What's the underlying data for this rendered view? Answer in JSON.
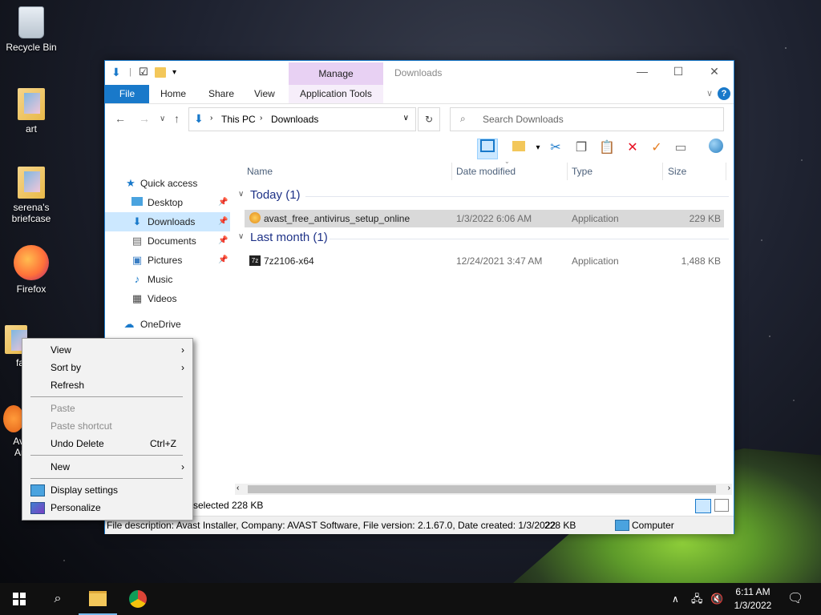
{
  "desktop": {
    "icons": [
      {
        "label": "Recycle Bin"
      },
      {
        "label": "art"
      },
      {
        "label": "serena's briefcase"
      },
      {
        "label": "Firefox"
      },
      {
        "label": "fa"
      },
      {
        "label": "Av\nAr"
      }
    ]
  },
  "window": {
    "title": "Downloads",
    "manage_tab": "Manage",
    "ribbon_tabs": [
      "File",
      "Home",
      "Share",
      "View",
      "Application Tools"
    ],
    "help": "?",
    "breadcrumb": [
      "This PC",
      "Downloads"
    ],
    "search_placeholder": "Search Downloads",
    "columns": [
      "Name",
      "Date modified",
      "Type",
      "Size"
    ],
    "groups": [
      {
        "label": "Today (1)",
        "files": [
          {
            "name": "avast_free_antivirus_setup_online",
            "date": "1/3/2022 6:06 AM",
            "type": "Application",
            "size": "229 KB",
            "selected": true
          }
        ]
      },
      {
        "label": "Last month (1)",
        "files": [
          {
            "name": "7z2106-x64",
            "date": "12/24/2021 3:47 AM",
            "type": "Application",
            "size": "1,488 KB",
            "selected": false
          }
        ]
      }
    ],
    "nav": {
      "quick_access": "Quick access",
      "items": [
        "Desktop",
        "Downloads",
        "Documents",
        "Pictures",
        "Music",
        "Videos"
      ],
      "onedrive": "OneDrive"
    },
    "status_left": "selected",
    "status_size": "228 KB",
    "info_text": "File description: Avast Installer, Company: AVAST Software, File version: 2.1.67.0, Date created: 1/3/2022",
    "info_size": "228 KB",
    "info_location": "Computer"
  },
  "context_menu": {
    "items": [
      {
        "label": "View",
        "submenu": true
      },
      {
        "label": "Sort by",
        "submenu": true
      },
      {
        "label": "Refresh"
      },
      {
        "label": "Paste",
        "disabled": true
      },
      {
        "label": "Paste shortcut",
        "disabled": true
      },
      {
        "label": "Undo Delete",
        "shortcut": "Ctrl+Z"
      },
      {
        "label": "New",
        "submenu": true
      },
      {
        "label": "Display settings"
      },
      {
        "label": "Personalize"
      }
    ]
  },
  "taskbar": {
    "time": "6:11 AM",
    "date": "1/3/2022"
  },
  "colors": {
    "accent": "#1979ca",
    "manage_tab": "#e8d1f3",
    "selection": "#cce8ff",
    "delete_red": "#e81123",
    "check_orange": "#e67e22"
  }
}
